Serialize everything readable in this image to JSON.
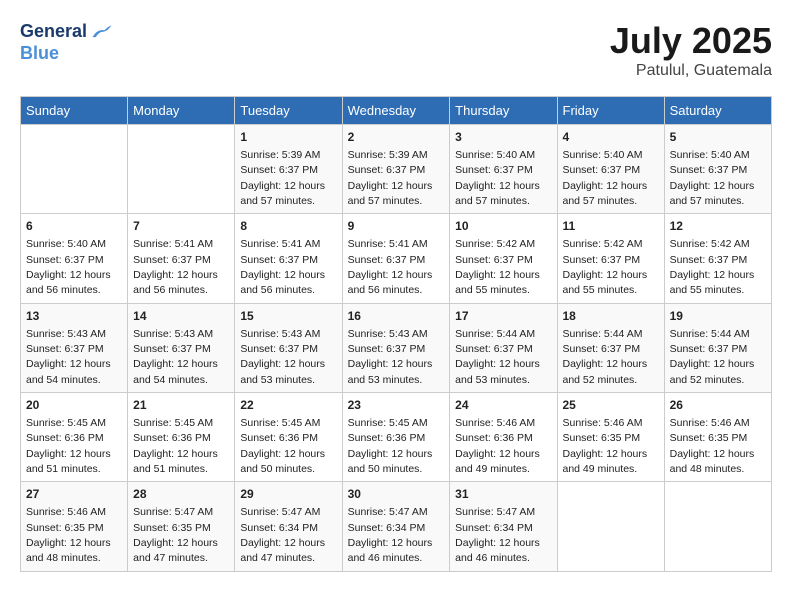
{
  "header": {
    "logo_line1": "General",
    "logo_line2": "Blue",
    "month": "July 2025",
    "location": "Patulul, Guatemala"
  },
  "days_of_week": [
    "Sunday",
    "Monday",
    "Tuesday",
    "Wednesday",
    "Thursday",
    "Friday",
    "Saturday"
  ],
  "weeks": [
    [
      null,
      null,
      {
        "day": 1,
        "sunrise": "5:39 AM",
        "sunset": "6:37 PM",
        "daylight": "12 hours and 57 minutes."
      },
      {
        "day": 2,
        "sunrise": "5:39 AM",
        "sunset": "6:37 PM",
        "daylight": "12 hours and 57 minutes."
      },
      {
        "day": 3,
        "sunrise": "5:40 AM",
        "sunset": "6:37 PM",
        "daylight": "12 hours and 57 minutes."
      },
      {
        "day": 4,
        "sunrise": "5:40 AM",
        "sunset": "6:37 PM",
        "daylight": "12 hours and 57 minutes."
      },
      {
        "day": 5,
        "sunrise": "5:40 AM",
        "sunset": "6:37 PM",
        "daylight": "12 hours and 57 minutes."
      }
    ],
    [
      {
        "day": 6,
        "sunrise": "5:40 AM",
        "sunset": "6:37 PM",
        "daylight": "12 hours and 56 minutes."
      },
      {
        "day": 7,
        "sunrise": "5:41 AM",
        "sunset": "6:37 PM",
        "daylight": "12 hours and 56 minutes."
      },
      {
        "day": 8,
        "sunrise": "5:41 AM",
        "sunset": "6:37 PM",
        "daylight": "12 hours and 56 minutes."
      },
      {
        "day": 9,
        "sunrise": "5:41 AM",
        "sunset": "6:37 PM",
        "daylight": "12 hours and 56 minutes."
      },
      {
        "day": 10,
        "sunrise": "5:42 AM",
        "sunset": "6:37 PM",
        "daylight": "12 hours and 55 minutes."
      },
      {
        "day": 11,
        "sunrise": "5:42 AM",
        "sunset": "6:37 PM",
        "daylight": "12 hours and 55 minutes."
      },
      {
        "day": 12,
        "sunrise": "5:42 AM",
        "sunset": "6:37 PM",
        "daylight": "12 hours and 55 minutes."
      }
    ],
    [
      {
        "day": 13,
        "sunrise": "5:43 AM",
        "sunset": "6:37 PM",
        "daylight": "12 hours and 54 minutes."
      },
      {
        "day": 14,
        "sunrise": "5:43 AM",
        "sunset": "6:37 PM",
        "daylight": "12 hours and 54 minutes."
      },
      {
        "day": 15,
        "sunrise": "5:43 AM",
        "sunset": "6:37 PM",
        "daylight": "12 hours and 53 minutes."
      },
      {
        "day": 16,
        "sunrise": "5:43 AM",
        "sunset": "6:37 PM",
        "daylight": "12 hours and 53 minutes."
      },
      {
        "day": 17,
        "sunrise": "5:44 AM",
        "sunset": "6:37 PM",
        "daylight": "12 hours and 53 minutes."
      },
      {
        "day": 18,
        "sunrise": "5:44 AM",
        "sunset": "6:37 PM",
        "daylight": "12 hours and 52 minutes."
      },
      {
        "day": 19,
        "sunrise": "5:44 AM",
        "sunset": "6:37 PM",
        "daylight": "12 hours and 52 minutes."
      }
    ],
    [
      {
        "day": 20,
        "sunrise": "5:45 AM",
        "sunset": "6:36 PM",
        "daylight": "12 hours and 51 minutes."
      },
      {
        "day": 21,
        "sunrise": "5:45 AM",
        "sunset": "6:36 PM",
        "daylight": "12 hours and 51 minutes."
      },
      {
        "day": 22,
        "sunrise": "5:45 AM",
        "sunset": "6:36 PM",
        "daylight": "12 hours and 50 minutes."
      },
      {
        "day": 23,
        "sunrise": "5:45 AM",
        "sunset": "6:36 PM",
        "daylight": "12 hours and 50 minutes."
      },
      {
        "day": 24,
        "sunrise": "5:46 AM",
        "sunset": "6:36 PM",
        "daylight": "12 hours and 49 minutes."
      },
      {
        "day": 25,
        "sunrise": "5:46 AM",
        "sunset": "6:35 PM",
        "daylight": "12 hours and 49 minutes."
      },
      {
        "day": 26,
        "sunrise": "5:46 AM",
        "sunset": "6:35 PM",
        "daylight": "12 hours and 48 minutes."
      }
    ],
    [
      {
        "day": 27,
        "sunrise": "5:46 AM",
        "sunset": "6:35 PM",
        "daylight": "12 hours and 48 minutes."
      },
      {
        "day": 28,
        "sunrise": "5:47 AM",
        "sunset": "6:35 PM",
        "daylight": "12 hours and 47 minutes."
      },
      {
        "day": 29,
        "sunrise": "5:47 AM",
        "sunset": "6:34 PM",
        "daylight": "12 hours and 47 minutes."
      },
      {
        "day": 30,
        "sunrise": "5:47 AM",
        "sunset": "6:34 PM",
        "daylight": "12 hours and 46 minutes."
      },
      {
        "day": 31,
        "sunrise": "5:47 AM",
        "sunset": "6:34 PM",
        "daylight": "12 hours and 46 minutes."
      },
      null,
      null
    ]
  ]
}
